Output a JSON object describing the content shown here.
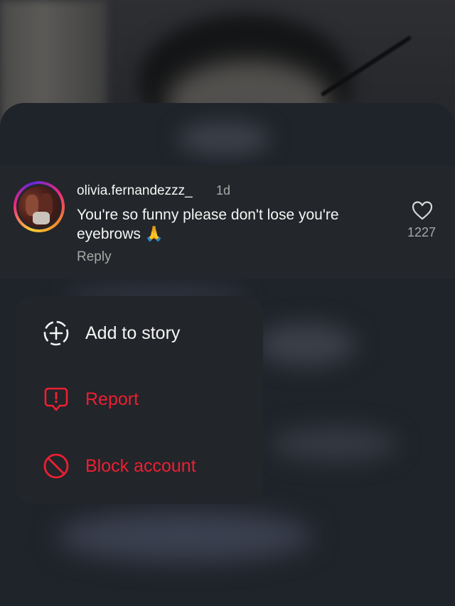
{
  "comment": {
    "username": "olivia.fernandezzz_",
    "timestamp": "1d",
    "text": "You're so funny please don't lose you're eyebrows 🙏",
    "reply_label": "Reply",
    "like_count": "1227",
    "like_icon": "heart-outline-icon",
    "avatar_ring_gradient": [
      "#f9ce34",
      "#ee2a7b",
      "#6228d7"
    ]
  },
  "menu": {
    "items": [
      {
        "label": "Add to story",
        "icon": "add-circle-dashed-icon",
        "color": "#f5f5f5"
      },
      {
        "label": "Report",
        "icon": "report-speech-bubble-icon",
        "color": "#ed1f33"
      },
      {
        "label": "Block account",
        "icon": "block-circle-slash-icon",
        "color": "#ed1f33"
      }
    ]
  },
  "colors": {
    "background": "#1b1e23",
    "card": "#23262a",
    "menu": "#222529",
    "danger": "#ed1f33",
    "text_primary": "#f5f5f5",
    "text_secondary": "#a8a8a8"
  }
}
